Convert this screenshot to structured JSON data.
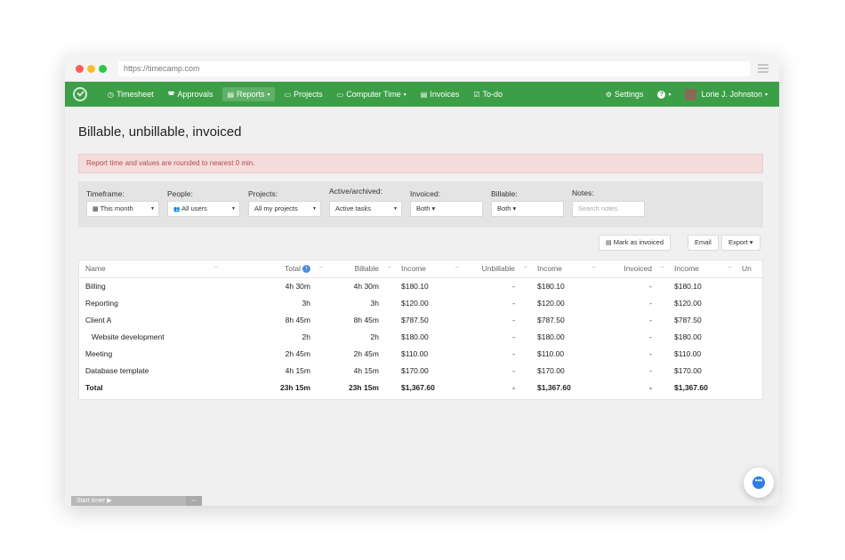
{
  "browser": {
    "url": "https://timecamp.com"
  },
  "nav": {
    "items": [
      {
        "label": "Timesheet",
        "icon": "clock-icon",
        "glyph": "◷"
      },
      {
        "label": "Approvals",
        "icon": "approvals-icon",
        "glyph": "◚"
      },
      {
        "label": "Reports",
        "icon": "report-icon",
        "glyph": "▤",
        "caret": "▾",
        "active": true
      },
      {
        "label": "Projects",
        "icon": "folder-icon",
        "glyph": "▭"
      },
      {
        "label": "Computer Time",
        "icon": "laptop-icon",
        "glyph": "▭",
        "caret": "▾"
      },
      {
        "label": "Invoices",
        "icon": "file-icon",
        "glyph": "▤"
      },
      {
        "label": "To-do",
        "icon": "check-square-icon",
        "glyph": "☑"
      }
    ],
    "settings_label": "Settings",
    "help_glyph": "?",
    "user_name": "Lorie J. Johnston",
    "caret": "▾",
    "gear_glyph": "⚙"
  },
  "page": {
    "title": "Billable, unbillable, invoiced",
    "alert": "Report time and values are rounded to nearest 0 min."
  },
  "filters": {
    "timeframe": {
      "label": "Timeframe:",
      "value": "This month",
      "icon_glyph": "▦"
    },
    "people": {
      "label": "People:",
      "value": "All users",
      "icon_glyph": "👥"
    },
    "projects": {
      "label": "Projects:",
      "value": "All my projects"
    },
    "active": {
      "label": "Active/archived:",
      "value": "Active tasks"
    },
    "invoiced": {
      "label": "Invoiced:",
      "value": "Both ▾"
    },
    "billable": {
      "label": "Billable:",
      "value": "Both ▾"
    },
    "notes": {
      "label": "Notes:",
      "placeholder": "Search notes"
    },
    "dropdown_glyph": "▼"
  },
  "actions": {
    "mark_invoiced": "Mark as invoiced",
    "email": "Email",
    "export": "Export ▾",
    "file_glyph": "▤"
  },
  "table": {
    "headers": [
      "Name",
      "Total",
      "Billable",
      "Income",
      "Unbillable",
      "Income",
      "Invoiced",
      "Income",
      "Un"
    ],
    "sort_glyph": "⇔",
    "info_glyph": "i",
    "rows": [
      [
        "Billing",
        "4h 30m",
        "4h 30m",
        "$180.10",
        "-",
        "$180.10",
        "-",
        "$180.10"
      ],
      [
        "Reporting",
        "3h",
        "3h",
        "$120.00",
        "-",
        "$120.00",
        "-",
        "$120.00"
      ],
      [
        "Client A",
        "8h 45m",
        "8h 45m",
        "$787.50",
        "-",
        "$787.50",
        "-",
        "$787.50"
      ],
      [
        "Website development",
        "2h",
        "2h",
        "$180.00",
        "-",
        "$180.00",
        "-",
        "$180.00"
      ],
      [
        "Meeting",
        "2h 45m",
        "2h 45m",
        "$110.00",
        "-",
        "$110.00",
        "-",
        "$110.00"
      ],
      [
        "Database template",
        "4h 15m",
        "4h 15m",
        "$170.00",
        "-",
        "$170.00",
        "-",
        "$170.00"
      ]
    ],
    "indented_rows": [
      3
    ],
    "total": [
      "Total",
      "23h 15m",
      "23h 15m",
      "$1,367.60",
      "-",
      "$1,367.60",
      "-",
      "$1,367.60"
    ]
  },
  "footer": {
    "start_timer": "Start timer ▶",
    "collapse_glyph": "︿"
  },
  "chat": {
    "glyph": "•••"
  },
  "colors": {
    "nav_green": "#3c9f48",
    "alert_bg": "#f4dcdc",
    "alert_text": "#b14d4d",
    "chat_blue": "#2e7ee6"
  }
}
